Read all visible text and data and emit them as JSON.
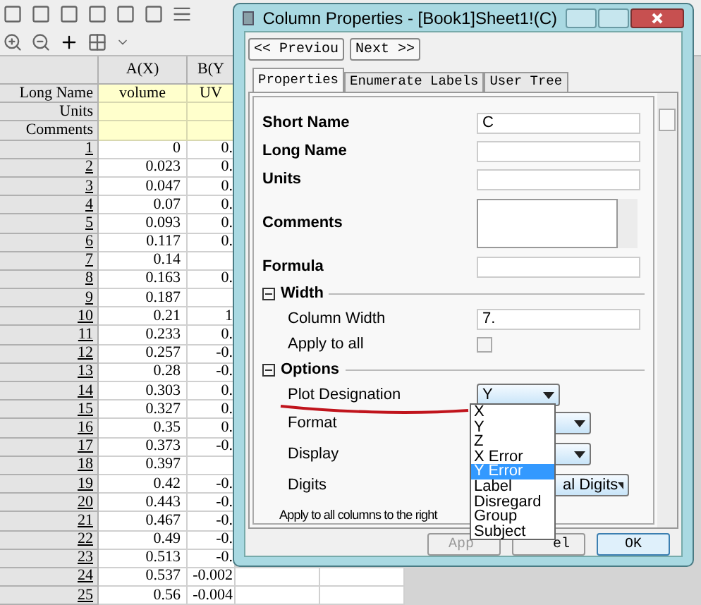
{
  "sheet": {
    "columns": [
      {
        "label": "A(X)"
      },
      {
        "label": "B(Y"
      }
    ],
    "label_rows": [
      {
        "label": "Long Name",
        "cells": [
          "volume",
          "UV"
        ]
      },
      {
        "label": "Units",
        "cells": []
      },
      {
        "label": "Comments",
        "cells": []
      }
    ],
    "rows": [
      {
        "n": "1",
        "a": "0",
        "b": "0."
      },
      {
        "n": "2",
        "a": "0.023",
        "b": "0."
      },
      {
        "n": "3",
        "a": "0.047",
        "b": "0."
      },
      {
        "n": "4",
        "a": "0.07",
        "b": "0."
      },
      {
        "n": "5",
        "a": "0.093",
        "b": "0."
      },
      {
        "n": "6",
        "a": "0.117",
        "b": "0."
      },
      {
        "n": "7",
        "a": "0.14"
      },
      {
        "n": "8",
        "a": "0.163",
        "b": "0."
      },
      {
        "n": "9",
        "a": "0.187"
      },
      {
        "n": "10",
        "a": "0.21",
        "b": "1"
      },
      {
        "n": "11",
        "a": "0.233",
        "b": "0."
      },
      {
        "n": "12",
        "a": "0.257",
        "b": "-0."
      },
      {
        "n": "13",
        "a": "0.28",
        "b": "-0."
      },
      {
        "n": "14",
        "a": "0.303",
        "b": "0."
      },
      {
        "n": "15",
        "a": "0.327",
        "b": "0."
      },
      {
        "n": "16",
        "a": "0.35",
        "b": "0."
      },
      {
        "n": "17",
        "a": "0.373",
        "b": "-0."
      },
      {
        "n": "18",
        "a": "0.397"
      },
      {
        "n": "19",
        "a": "0.42",
        "b": "-0."
      },
      {
        "n": "20",
        "a": "0.443",
        "b": "-0."
      },
      {
        "n": "21",
        "a": "0.467",
        "b": "-0."
      },
      {
        "n": "22",
        "a": "0.49",
        "b": "-0."
      },
      {
        "n": "23",
        "a": "0.513",
        "b": "-0."
      },
      {
        "n": "24",
        "a": "0.537",
        "b": "-0.002"
      },
      {
        "n": "25",
        "a": "0.56",
        "b": "-0.004"
      }
    ]
  },
  "dialog": {
    "title": "Column Properties - [Book1]Sheet1!(C)",
    "nav_buttons": [
      "<< Previou",
      "Next >>"
    ],
    "tabs": [
      {
        "label": "Properties",
        "selected": true
      },
      {
        "label": "Enumerate Labels",
        "selected": false
      },
      {
        "label": "User Tree",
        "selected": false
      }
    ],
    "fields": [
      {
        "label": "Short Name",
        "kind": "text",
        "value": "C"
      },
      {
        "label": "Long Name",
        "kind": "text"
      },
      {
        "label": "Units",
        "kind": "text"
      },
      {
        "label": "Comments",
        "kind": "textarea"
      },
      {
        "label": "Formula",
        "kind": "text"
      }
    ],
    "sections": [
      {
        "title": "Width",
        "expanded": true,
        "items": [
          {
            "label": "Column Width",
            "kind": "text",
            "value": "7."
          },
          {
            "label": "Apply to all",
            "kind": "checkbox",
            "checked": false
          }
        ]
      },
      {
        "title": "Options",
        "expanded": true,
        "items": [
          {
            "label": "Plot Designation",
            "kind": "combo",
            "value": "Y"
          },
          {
            "label": "Format",
            "kind": "combo"
          },
          {
            "label": "Display",
            "kind": "combo"
          },
          {
            "label": "Digits",
            "kind": "combo",
            "value": "al Digits"
          },
          {
            "label": "Apply to all columns to the right",
            "kind": "label"
          }
        ]
      }
    ],
    "dropdown": {
      "options": [
        {
          "label": "X",
          "selected": false
        },
        {
          "label": "Y",
          "selected": false
        },
        {
          "label": "Z",
          "selected": false
        },
        {
          "label": "X Error",
          "selected": false
        },
        {
          "label": "Y Error",
          "selected": true
        },
        {
          "label": "Label",
          "selected": false
        },
        {
          "label": "Disregard",
          "selected": false
        },
        {
          "label": "Group",
          "selected": false
        },
        {
          "label": "Subject",
          "selected": false
        }
      ]
    },
    "buttons": [
      "App",
      "el",
      "OK"
    ]
  }
}
